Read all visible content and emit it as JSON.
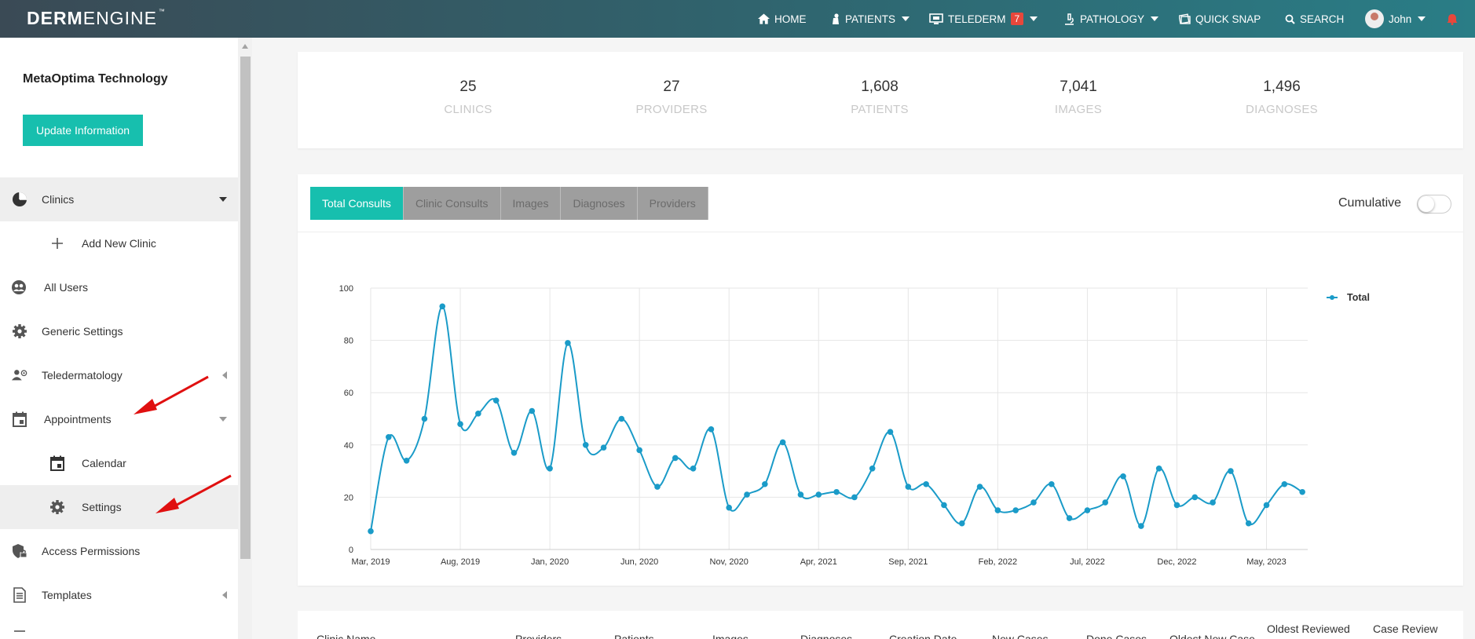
{
  "brand": {
    "bold": "DERM",
    "light": "ENGINE",
    "tm": "™"
  },
  "nav": {
    "home": "HOME",
    "patients": "PATIENTS",
    "telederm": "TELEDERM",
    "telederm_badge": "7",
    "pathology": "PATHOLOGY",
    "quick_snap": "QUICK SNAP",
    "search": "SEARCH",
    "user": "John"
  },
  "sidebar": {
    "org_name": "MetaOptima Technology",
    "update_button": "Update Information",
    "items": [
      {
        "label": "Clinics"
      },
      {
        "label": "Add New Clinic"
      },
      {
        "label": "All Users"
      },
      {
        "label": "Generic Settings"
      },
      {
        "label": "Teledermatology"
      },
      {
        "label": "Appointments"
      },
      {
        "label": "Calendar"
      },
      {
        "label": "Settings"
      },
      {
        "label": "Access Permissions"
      },
      {
        "label": "Templates"
      }
    ]
  },
  "stats": [
    {
      "value": "25",
      "label": "CLINICS"
    },
    {
      "value": "27",
      "label": "PROVIDERS"
    },
    {
      "value": "1,608",
      "label": "PATIENTS"
    },
    {
      "value": "7,041",
      "label": "IMAGES"
    },
    {
      "value": "1,496",
      "label": "DIAGNOSES"
    }
  ],
  "tabs": [
    "Total Consults",
    "Clinic Consults",
    "Images",
    "Diagnoses",
    "Providers"
  ],
  "cumulative_label": "Cumulative",
  "chart_data": {
    "type": "line",
    "title": "",
    "xlabel": "",
    "ylabel": "",
    "ylim": [
      0,
      100
    ],
    "yticks": [
      0,
      20,
      40,
      60,
      80,
      100
    ],
    "xticks": [
      "Mar, 2019",
      "Aug, 2019",
      "Jan, 2020",
      "Jun, 2020",
      "Nov, 2020",
      "Apr, 2021",
      "Sep, 2021",
      "Feb, 2022",
      "Jul, 2022",
      "Dec, 2022",
      "May, 2023"
    ],
    "legend": "top-right",
    "grid": true,
    "color": "#1a9bc8",
    "series": [
      {
        "name": "Total",
        "x": [
          "2019-03",
          "2019-04",
          "2019-05",
          "2019-06",
          "2019-07",
          "2019-08",
          "2019-09",
          "2019-10",
          "2019-11",
          "2019-12",
          "2020-01",
          "2020-02",
          "2020-03",
          "2020-04",
          "2020-05",
          "2020-06",
          "2020-07",
          "2020-08",
          "2020-09",
          "2020-10",
          "2020-11",
          "2020-12",
          "2021-01",
          "2021-02",
          "2021-03",
          "2021-04",
          "2021-05",
          "2021-06",
          "2021-07",
          "2021-08",
          "2021-09",
          "2021-10",
          "2021-11",
          "2021-12",
          "2022-01",
          "2022-02",
          "2022-03",
          "2022-04",
          "2022-05",
          "2022-06",
          "2022-07",
          "2022-08",
          "2022-09",
          "2022-10",
          "2022-11",
          "2022-12",
          "2023-01",
          "2023-02",
          "2023-03",
          "2023-04",
          "2023-05",
          "2023-06",
          "2023-07"
        ],
        "values": [
          7,
          43,
          34,
          50,
          93,
          48,
          52,
          57,
          37,
          53,
          31,
          79,
          40,
          39,
          50,
          38,
          24,
          35,
          31,
          46,
          16,
          21,
          25,
          41,
          21,
          21,
          22,
          20,
          31,
          45,
          24,
          25,
          17,
          10,
          24,
          15,
          15,
          18,
          25,
          12,
          15,
          18,
          28,
          9,
          31,
          17,
          20,
          18,
          30,
          10,
          17,
          25,
          22
        ]
      }
    ]
  },
  "table_headers": [
    "Clinic Name",
    "Providers",
    "Patients",
    "Images",
    "Diagnoses",
    "Creation Date",
    "New Cases",
    "Done Cases",
    "Oldest New Case",
    "Oldest Reviewed",
    "Case Review"
  ]
}
